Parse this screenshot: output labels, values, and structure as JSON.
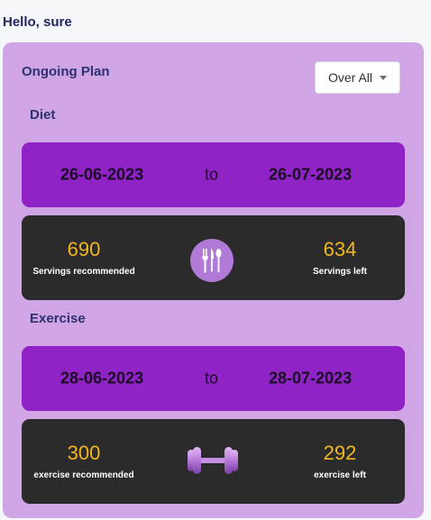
{
  "greeting": "Hello, sure",
  "plan": {
    "title": "Ongoing Plan",
    "filter": {
      "selected": "Over All"
    }
  },
  "diet": {
    "label": "Diet",
    "start_date": "26-06-2023",
    "to_text": "to",
    "end_date": "26-07-2023",
    "recommended_value": "690",
    "recommended_label": "Servings recommended",
    "left_value": "634",
    "left_label": "Servings left",
    "icon": "utensils-icon"
  },
  "exercise": {
    "label": "Exercise",
    "start_date": "28-06-2023",
    "to_text": "to",
    "end_date": "28-07-2023",
    "recommended_value": "300",
    "recommended_label": "exercise recommended",
    "left_value": "292",
    "left_label": "exercise left",
    "icon": "dumbbell-icon"
  },
  "colors": {
    "panel": "#cfa5e6",
    "date_bar": "#8f23c6",
    "stat_card": "#2c2b2c",
    "stat_value": "#f3b61f",
    "heading": "#2f3270"
  }
}
